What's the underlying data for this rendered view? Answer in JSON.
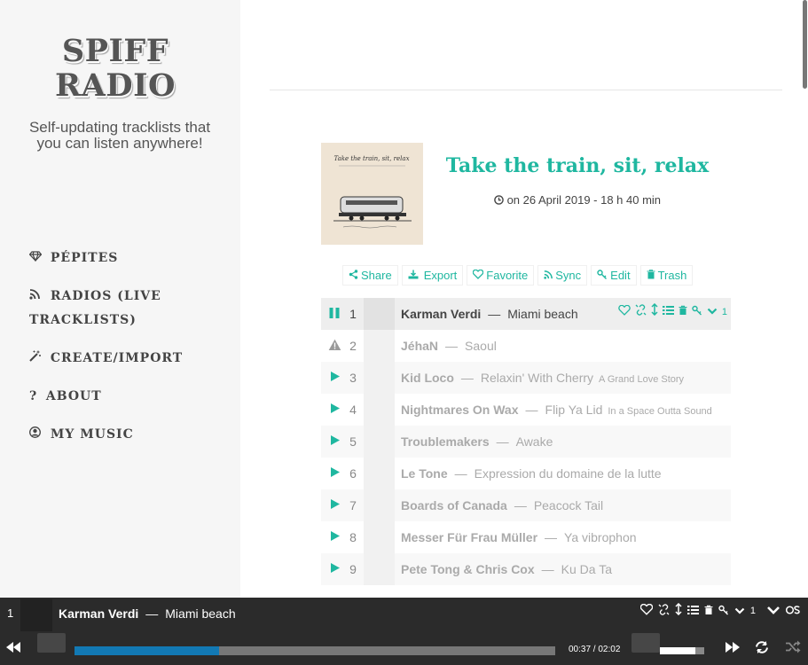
{
  "site": {
    "title_line1": "SPIFF",
    "title_line2": "RADIO",
    "tagline": "Self-updating tracklists that you can listen anywhere!"
  },
  "nav": {
    "items": [
      {
        "icon": "diamond-icon",
        "label": "PÉPITES"
      },
      {
        "icon": "rss-icon",
        "label": "RADIOS (LIVE TRACKLISTS)"
      },
      {
        "icon": "magic-wand-icon",
        "label": "CREATE/IMPORT"
      },
      {
        "icon": "question-icon",
        "label": "ABOUT"
      },
      {
        "icon": "user-circle-icon",
        "label": "MY MUSIC"
      }
    ]
  },
  "playlist": {
    "title": "Take the train, sit, relax",
    "date": "on 26 April 2019 - 18 h 40 min",
    "actions": [
      {
        "icon": "share-icon",
        "label": "Share"
      },
      {
        "icon": "export-icon",
        "label": "Export"
      },
      {
        "icon": "heart-icon",
        "label": "Favorite"
      },
      {
        "icon": "rss-icon",
        "label": "Sync"
      },
      {
        "icon": "key-icon",
        "label": "Edit"
      },
      {
        "icon": "trash-icon",
        "label": "Trash"
      }
    ],
    "tracks": [
      {
        "num": "1",
        "artist": "Karman Verdi",
        "title": "Miami beach",
        "album": "",
        "status": "pause"
      },
      {
        "num": "2",
        "artist": "JéhaN",
        "title": "Saoul",
        "album": "",
        "status": "warning"
      },
      {
        "num": "3",
        "artist": "Kid Loco",
        "title": "Relaxin' With Cherry",
        "album": "A Grand Love Story",
        "status": "play"
      },
      {
        "num": "4",
        "artist": "Nightmares On Wax",
        "title": "Flip Ya Lid",
        "album": "In a Space Outta Sound",
        "status": "play"
      },
      {
        "num": "5",
        "artist": "Troublemakers",
        "title": "Awake",
        "album": "",
        "status": "play"
      },
      {
        "num": "6",
        "artist": "Le Tone",
        "title": "Expression du domaine de la lutte",
        "album": "",
        "status": "play"
      },
      {
        "num": "7",
        "artist": "Boards of Canada",
        "title": "Peacock Tail",
        "album": "",
        "status": "play"
      },
      {
        "num": "8",
        "artist": "Messer Für Frau Müller",
        "title": "Ya vibrophon",
        "album": "",
        "status": "play"
      },
      {
        "num": "9",
        "artist": "Pete Tong & Chris Cox",
        "title": "Ku Da Ta",
        "album": "",
        "status": "play"
      }
    ],
    "track_tool_count": "1"
  },
  "player": {
    "num": "1",
    "artist": "Karman Verdi",
    "title": "Miami beach",
    "time": "00:37 / 02:02",
    "progress": 0.3,
    "volume": 0.8,
    "tool_count": "1"
  },
  "colors": {
    "accent": "#1fb7a0",
    "player_bg": "#2b2b2b",
    "progress_fill": "#1279b4"
  }
}
